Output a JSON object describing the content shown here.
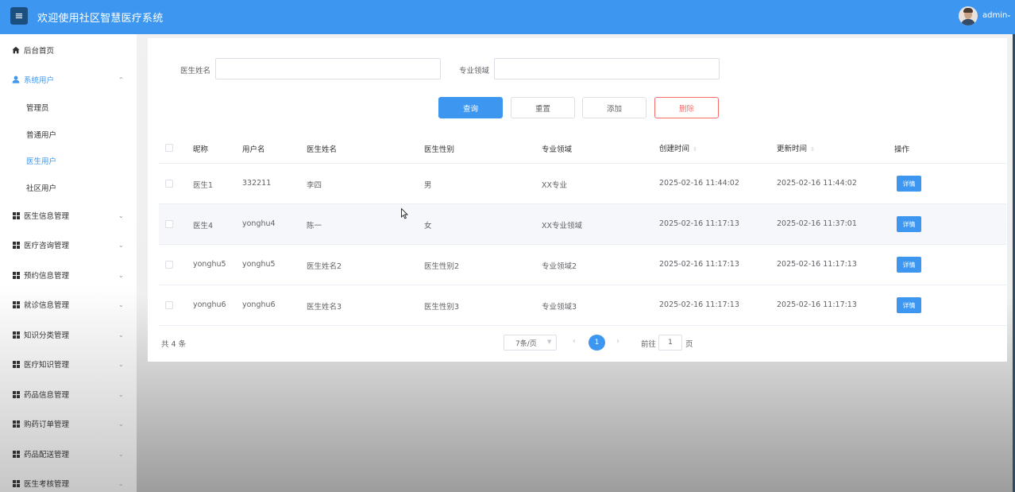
{
  "header": {
    "title": "欢迎使用社区智慧医疗系统",
    "menu_icon": "≡",
    "user": "admin",
    "user_caret": "⌄"
  },
  "sidebar": {
    "items": [
      {
        "label": "后台首页",
        "icon": "home-icon"
      },
      {
        "label": "系统用户",
        "icon": "user-icon",
        "caret": "⌃"
      },
      {
        "label": "管理员"
      },
      {
        "label": "普通用户"
      },
      {
        "label": "医生用户"
      },
      {
        "label": "社区用户"
      },
      {
        "label": "医生信息管理",
        "icon": "grid-icon",
        "caret": "⌄"
      },
      {
        "label": "医疗咨询管理",
        "icon": "grid-icon",
        "caret": "⌄"
      },
      {
        "label": "预约信息管理",
        "icon": "grid-icon",
        "caret": "⌄"
      },
      {
        "label": "就诊信息管理",
        "icon": "grid-icon",
        "caret": "⌄"
      },
      {
        "label": "知识分类管理",
        "icon": "grid-icon",
        "caret": "⌄"
      },
      {
        "label": "医疗知识管理",
        "icon": "grid-icon",
        "caret": "⌄"
      },
      {
        "label": "药品信息管理",
        "icon": "grid-icon",
        "caret": "⌄"
      },
      {
        "label": "购药订单管理",
        "icon": "grid-icon",
        "caret": "⌄"
      },
      {
        "label": "药品配送管理",
        "icon": "grid-icon",
        "caret": "⌄"
      },
      {
        "label": "医生考核管理",
        "icon": "grid-icon",
        "caret": "⌄"
      }
    ]
  },
  "search": {
    "doctor_name_label": "医生姓名",
    "doctor_name_value": "",
    "specialty_label": "专业领域",
    "specialty_value": ""
  },
  "buttons": {
    "query": "查询",
    "reset": "重置",
    "add": "添加",
    "delete": "删除"
  },
  "table": {
    "columns": [
      "昵称",
      "用户名",
      "医生姓名",
      "医生性别",
      "专业领域",
      "创建时间",
      "更新时间",
      "操作"
    ],
    "sort_icon": "⇳",
    "detail_label": "详情",
    "rows": [
      [
        "医生1",
        "332211",
        "李四",
        "男",
        "XX专业",
        "2025-02-16 11:44:02",
        "2025-02-16 11:44:02"
      ],
      [
        "医生4",
        "yonghu4",
        "陈一",
        "女",
        "XX专业领域",
        "2025-02-16 11:17:13",
        "2025-02-16 11:37:01"
      ],
      [
        "yonghu5",
        "yonghu5",
        "医生姓名2",
        "医生性别2",
        "专业领域2",
        "2025-02-16 11:17:13",
        "2025-02-16 11:17:13"
      ],
      [
        "yonghu6",
        "yonghu6",
        "医生姓名3",
        "医生性别3",
        "专业领域3",
        "2025-02-16 11:17:13",
        "2025-02-16 11:17:13"
      ]
    ]
  },
  "pagination": {
    "total": "共 4 条",
    "page_size": "7条/页",
    "prev": "‹",
    "next": "›",
    "current_page": "1",
    "goto_prefix": "前往",
    "goto_value": "1",
    "goto_suffix": "页"
  },
  "colors": {
    "primary": "#3d97f0",
    "danger": "#f56c6c",
    "header_bg": "#3d97f0"
  }
}
